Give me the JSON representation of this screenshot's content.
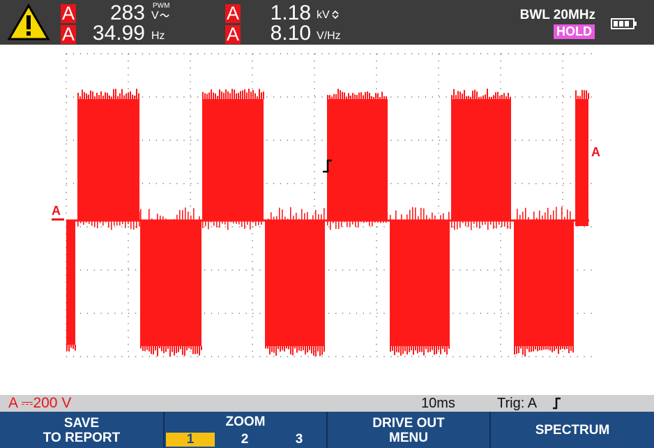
{
  "header": {
    "row1": {
      "channel": "A",
      "value1": "283",
      "unit1": "V",
      "unit1_sub": "PWM",
      "channel2": "A",
      "value2": "1.18",
      "unit2": "kV"
    },
    "row2": {
      "channel": "A",
      "value1": "34.99",
      "unit1": "Hz",
      "channel2": "A",
      "value2": "8.10",
      "unit2": "V/Hz"
    },
    "bandwidth": "BWL 20MHz",
    "hold_badge": "HOLD",
    "icons": [
      "warning-icon",
      "battery-icon"
    ]
  },
  "scope": {
    "channel_marker_left": "A",
    "channel_marker_right": "A",
    "trace_color": "#ff1a1a",
    "grid_color": "#555555"
  },
  "status": {
    "scale": "A ⎓200 V",
    "timebase": "10ms",
    "trigger": "Trig: A"
  },
  "softkeys": {
    "save": {
      "line1": "SAVE",
      "line2": "TO REPORT"
    },
    "zoom": {
      "label": "ZOOM",
      "options": [
        "1",
        "2",
        "3"
      ],
      "selected": "1"
    },
    "drive": {
      "line1": "DRIVE OUT",
      "line2": "MENU"
    },
    "spectrum": {
      "line1": "SPECTRUM"
    }
  },
  "colors": {
    "channel_red": "#e8141b",
    "hold_magenta": "#e65bdc",
    "softkey_blue": "#1e4b82",
    "zoom_active": "#f5c013"
  }
}
